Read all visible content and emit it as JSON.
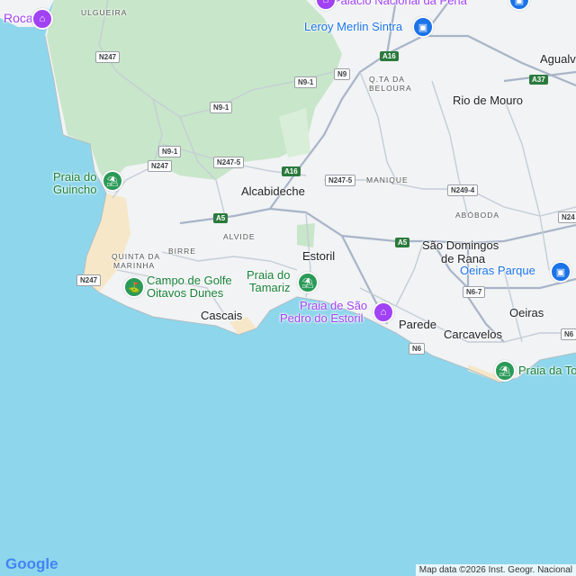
{
  "map": {
    "towns": {
      "alcabideche": "Alcabideche",
      "estoril": "Estoril",
      "cascais": "Cascais",
      "rio_de_mouro": "Rio de Mouro",
      "sao_domingos": "São Domingos",
      "de_rana": "de Rana",
      "oeiras": "Oeiras",
      "parede": "Parede",
      "carcavelos": "Carcavelos",
      "agualva": "Agualv"
    },
    "localities": {
      "ulgueira": "ULGUEIRA",
      "q_ta_da": "Q.TA DA",
      "beloura": "BELOURA",
      "manique": "MANIQUE",
      "aboboda": "ABÓBODA",
      "alvide": "ALVIDE",
      "birre": "BIRRE",
      "quinta_da": "QUINTA DA",
      "marinha": "MARINHA"
    },
    "pois": {
      "roca": "Roca",
      "palacio": "Palácio Nacional da Pena",
      "leroy": "Leroy Merlin Sintra",
      "guincho_1": "Praia do",
      "guincho_2": "Guincho",
      "golfe_1": "Campo de Golfe",
      "golfe_2": "Oitavos Dunes",
      "tamariz_1": "Praia do",
      "tamariz_2": "Tamariz",
      "sao_pedro_1": "Praia de São",
      "sao_pedro_2": "Pedro do Estoril",
      "oeiras_parque": "Oeiras Parque",
      "praia_torre": "Praia da To"
    },
    "roads": {
      "n247_a": "N247",
      "n9_1_a": "N9-1",
      "n9": "N9",
      "n9_1_b": "N9-1",
      "n9_1_c": "N9-1",
      "n247_b": "N247",
      "n247_5_a": "N247-5",
      "n247_5_b": "N247-5",
      "n249_4": "N249-4",
      "n247_c": "N247",
      "n6_7": "N6-7",
      "n6": "N6",
      "n6_b": "N6",
      "n24": "N24",
      "a16_a": "A16",
      "a16_b": "A16",
      "a37": "A37",
      "a5_a": "A5",
      "a5_b": "A5"
    },
    "attribution": "Map data ©2026 Inst. Geogr. Nacional",
    "logo": "Google",
    "colors": {
      "sea": "#8ed6ec",
      "land": "#f1f3f4",
      "park": "#c8e6c9",
      "beach": "#f6e7c8",
      "road": "#a8b4c8"
    }
  }
}
